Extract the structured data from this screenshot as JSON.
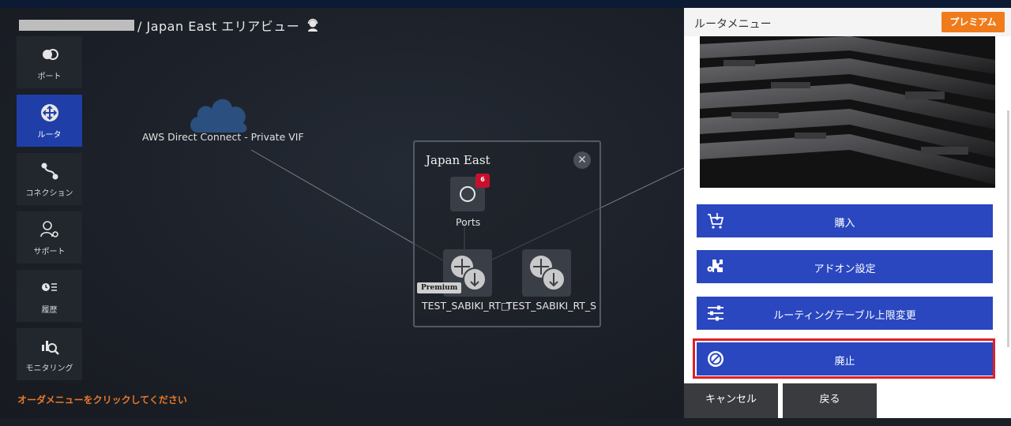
{
  "breadcrumb": {
    "area_text": "/ Japan East エリアビュー"
  },
  "sidenav": [
    {
      "label": "ポート",
      "icon": "port-icon"
    },
    {
      "label": "ルータ",
      "icon": "router-icon",
      "active": true
    },
    {
      "label": "コネクション",
      "icon": "connection-icon"
    },
    {
      "label": "サポート",
      "icon": "support-icon"
    },
    {
      "label": "履歴",
      "icon": "history-icon"
    },
    {
      "label": "モニタリング",
      "icon": "monitoring-icon"
    }
  ],
  "hint": "オーダメニューをクリックしてください",
  "cloud": {
    "label": "AWS Direct Connect - Private VIF"
  },
  "area": {
    "title": "Japan East",
    "close": "✕",
    "ports_label": "Ports",
    "ports_badge": "6",
    "premium_tag": "Premium",
    "router1_label": "TEST_SABIKI_RT□",
    "router2_label": "TEST_SABIKI_RT_S"
  },
  "panel": {
    "title": "ルータメニュー",
    "premium_button": "プレミアム",
    "actions": [
      {
        "label": "購入",
        "icon": "cart-icon"
      },
      {
        "label": "アドオン設定",
        "icon": "puzzle-icon"
      },
      {
        "label": "ルーティングテーブル上限変更",
        "icon": "sliders-icon"
      },
      {
        "label": "廃止",
        "icon": "ban-icon"
      }
    ],
    "cancel": "キャンセル",
    "back": "戻る"
  },
  "colors": {
    "accent_blue": "#2a47c0",
    "nav_active": "#1f3ea8",
    "premium_orange": "#f07b1a",
    "highlight_red": "#e01f26",
    "badge_red": "#c8102e",
    "hint_orange": "#e8782a"
  }
}
